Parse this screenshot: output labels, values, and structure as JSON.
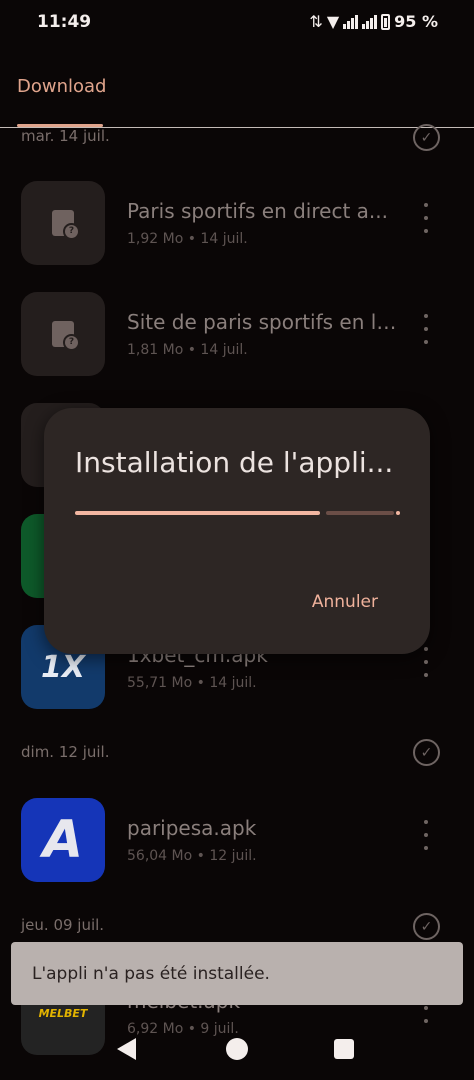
{
  "status_bar": {
    "time": "11:49",
    "battery": "95 %",
    "icons": [
      "data-arrows-icon",
      "wifi-icon",
      "signal-1-icon",
      "signal-2-icon",
      "battery-icon"
    ]
  },
  "top_bar": {
    "tab_label": "Download"
  },
  "sections": [
    {
      "date": "mar. 14 juil.",
      "items": [
        {
          "title": "Paris sportifs en direct a...",
          "meta": "1,92 Mo • 14 juil.",
          "icon": "unknown-file-icon"
        },
        {
          "title": "Site de paris sportifs en li...",
          "meta": "1,81 Mo • 14 juil.",
          "icon": "unknown-file-icon"
        },
        {
          "title": "",
          "meta": "",
          "icon": "unknown-file-icon"
        },
        {
          "title": "",
          "meta": "",
          "icon": "green-app-icon"
        },
        {
          "title": "1xbet_cm.apk",
          "meta": "55,71 Mo • 14 juil.",
          "icon": "1xbet-app-icon",
          "icon_text": "1X"
        }
      ]
    },
    {
      "date": "dim. 12 juil.",
      "items": [
        {
          "title": "paripesa.apk",
          "meta": "56,04 Mo • 12 juil.",
          "icon": "paripesa-app-icon",
          "icon_text": "A"
        }
      ]
    },
    {
      "date": "jeu. 09 juil.",
      "items": [
        {
          "title": "melbet.apk",
          "meta": "6,92 Mo • 9 juil.",
          "icon": "melbet-app-icon",
          "icon_text": "MELBET"
        }
      ]
    }
  ],
  "dialog": {
    "title": "Installation de l'appli...",
    "progress": 0.82,
    "cancel_label": "Annuler"
  },
  "snackbar": {
    "text": "L'appli n'a pas été installée."
  },
  "colors": {
    "accent": "#e0a48c",
    "dialog_bg": "#2d2624",
    "progress": "#f2b6a1",
    "snackbar_bg": "#b9b1ae"
  }
}
